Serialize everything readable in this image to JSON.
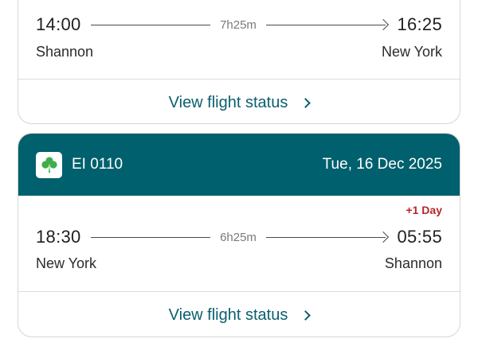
{
  "flight1": {
    "departure_time": "14:00",
    "duration": "7h25m",
    "arrival_time": "16:25",
    "origin": "Shannon",
    "destination": "New York",
    "status_link": "View flight status"
  },
  "flight2": {
    "flight_number": "EI 0110",
    "date": "Tue, 16 Dec 2025",
    "day_offset": "+1 Day",
    "departure_time": "18:30",
    "duration": "6h25m",
    "arrival_time": "05:55",
    "origin": "New York",
    "destination": "Shannon",
    "status_link": "View flight status"
  },
  "icons": {
    "airline_logo": "shamrock-icon",
    "arrow": "arrow-right-icon",
    "chevron": "chevron-right-icon"
  },
  "colors": {
    "header_bg": "#00606d",
    "link": "#0b5f6e",
    "day_offset": "#b3282d",
    "logo_green": "#3fae49"
  }
}
